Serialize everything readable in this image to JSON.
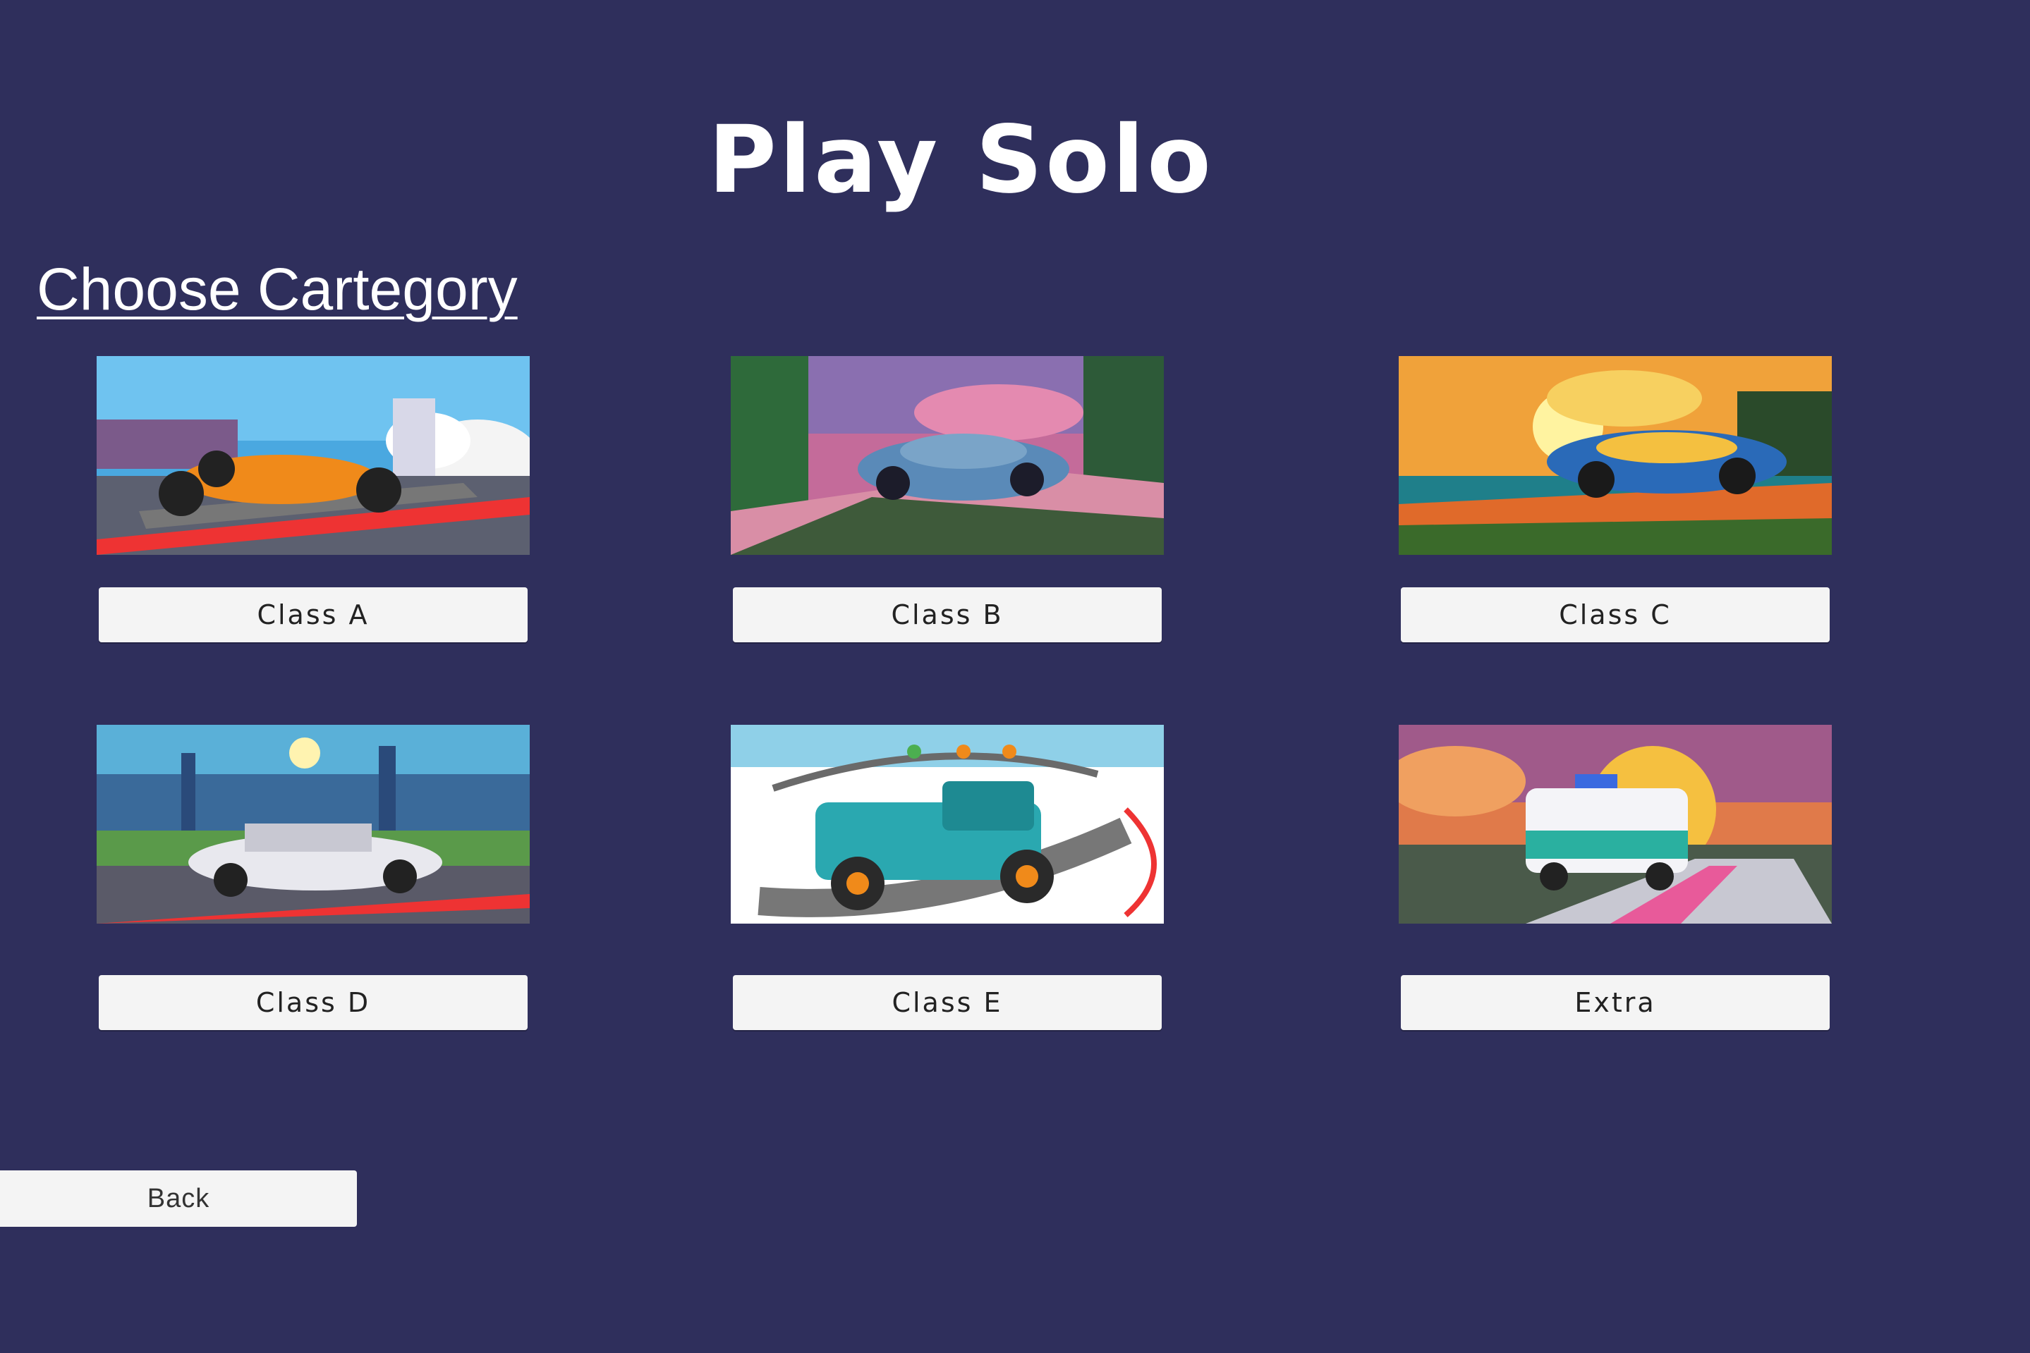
{
  "page": {
    "title": "Play Solo",
    "subtitle": "Choose Cartegory"
  },
  "categories": [
    {
      "label": "Class A",
      "image": "formula-car-image"
    },
    {
      "label": "Class B",
      "image": "sports-coupe-image"
    },
    {
      "label": "Class C",
      "image": "gt-racer-image"
    },
    {
      "label": "Class D",
      "image": "retro-coupe-image"
    },
    {
      "label": "Class E",
      "image": "pickup-truck-image"
    },
    {
      "label": "Extra",
      "image": "ambulance-image"
    }
  ],
  "nav": {
    "back_label": "Back"
  },
  "colors": {
    "background": "#2f2f5c",
    "button": "#f4f4f4",
    "text": "#ffffff"
  }
}
